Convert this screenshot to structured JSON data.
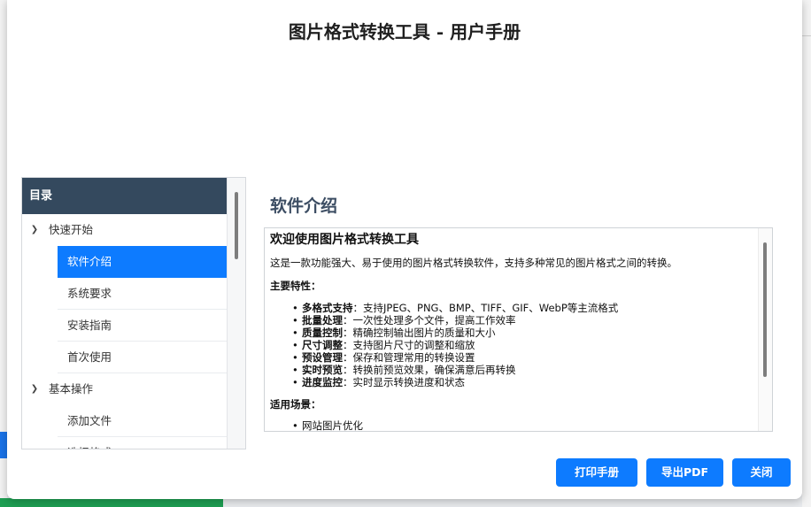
{
  "dialog": {
    "title": "图片格式转换工具 - 用户手册"
  },
  "toc": {
    "header": "目录",
    "items": [
      {
        "type": "group",
        "label": "快速开始",
        "expanded": true
      },
      {
        "type": "child",
        "label": "软件介绍",
        "selected": true
      },
      {
        "type": "child",
        "label": "系统要求"
      },
      {
        "type": "child",
        "label": "安装指南"
      },
      {
        "type": "child",
        "label": "首次使用"
      },
      {
        "type": "group",
        "label": "基本操作",
        "expanded": true
      },
      {
        "type": "child",
        "label": "添加文件"
      },
      {
        "type": "child",
        "label": "选择格式"
      }
    ]
  },
  "content": {
    "heading": "软件介绍",
    "doc_title": "欢迎使用图片格式转换工具",
    "intro": "这是一款功能强大、易于使用的图片格式转换软件，支持多种常见的图片格式之间的转换。",
    "features_title": "主要特性：",
    "features": [
      {
        "name": "多格式支持",
        "desc": "支持JPEG、PNG、BMP、TIFF、GIF、WebP等主流格式"
      },
      {
        "name": "批量处理",
        "desc": "一次性处理多个文件，提高工作效率"
      },
      {
        "name": "质量控制",
        "desc": "精确控制输出图片的质量和大小"
      },
      {
        "name": "尺寸调整",
        "desc": "支持图片尺寸的调整和缩放"
      },
      {
        "name": "预设管理",
        "desc": "保存和管理常用的转换设置"
      },
      {
        "name": "实时预览",
        "desc": "转换前预览效果，确保满意后再转换"
      },
      {
        "name": "进度监控",
        "desc": "实时显示转换进度和状态"
      }
    ],
    "scenarios_title": "适用场景：",
    "scenarios": [
      "网站图片优化"
    ]
  },
  "buttons": {
    "print": "打印手册",
    "export": "导出PDF",
    "close": "关闭"
  },
  "colors": {
    "accent": "#0d7bff",
    "toc_header": "#34495e",
    "heading": "#3c4d63"
  }
}
